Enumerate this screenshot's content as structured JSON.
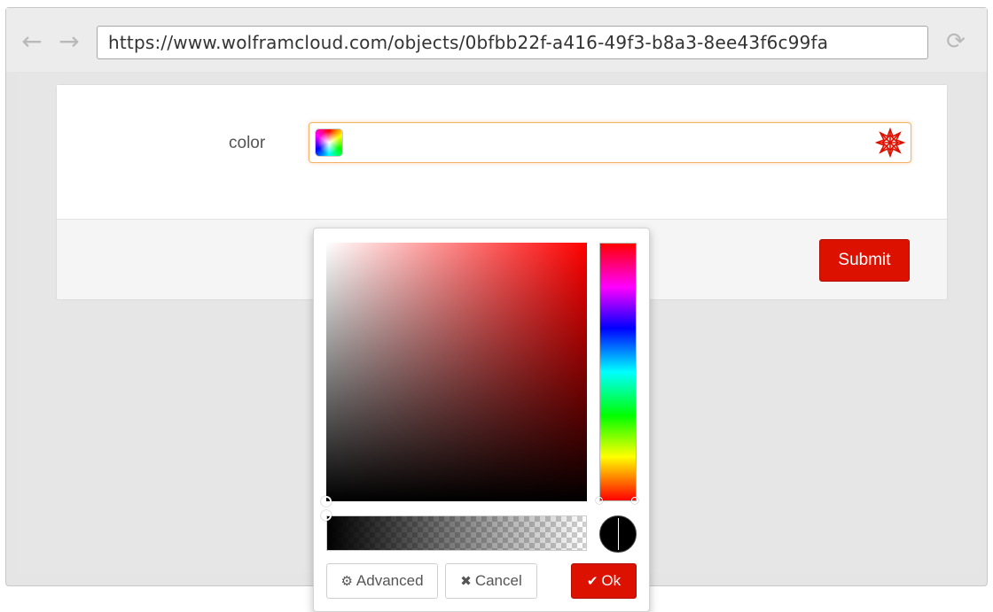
{
  "browser": {
    "url": "https://www.wolframcloud.com/objects/0bfbb22f-a416-49f3-b8a3-8ee43f6c99fa",
    "back_icon": "arrow-left-icon",
    "forward_icon": "arrow-right-icon",
    "reload_icon": "reload-icon"
  },
  "form": {
    "field_label": "color",
    "field_value": "",
    "submit_label": "Submit"
  },
  "picker": {
    "hue_color": "#ff0000",
    "selected_color": "#000000",
    "buttons": {
      "advanced_label": "Advanced",
      "cancel_label": "Cancel",
      "ok_label": "Ok"
    }
  },
  "colors": {
    "accent": "#dd1100",
    "focus_border": "#f3b46a"
  }
}
